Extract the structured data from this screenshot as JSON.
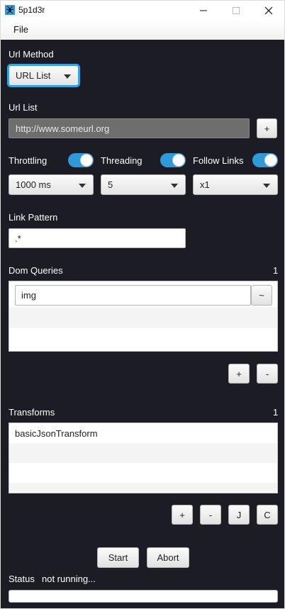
{
  "window": {
    "title": "5p1d3r"
  },
  "menu": {
    "file": "File"
  },
  "url_method": {
    "label": "Url Method",
    "selected": "URL List"
  },
  "url_list": {
    "label": "Url List",
    "value": "http://www.someurl.org",
    "add_label": "+"
  },
  "throttling": {
    "label": "Throttling",
    "enabled": true,
    "selected": "1000 ms"
  },
  "threading": {
    "label": "Threading",
    "enabled": true,
    "selected": "5"
  },
  "follow_links": {
    "label": "Follow Links",
    "enabled": true,
    "selected": "x1"
  },
  "link_pattern": {
    "label": "Link Pattern",
    "value": ".*"
  },
  "dom_queries": {
    "label": "Dom Queries",
    "count": "1",
    "items": [
      "img"
    ],
    "edit_label": "~",
    "add_label": "+",
    "remove_label": "-"
  },
  "transforms": {
    "label": "Transforms",
    "count": "1",
    "items": [
      "basicJsonTransform"
    ],
    "add_label": "+",
    "remove_label": "-",
    "json_label": "J",
    "custom_label": "C"
  },
  "actions": {
    "start": "Start",
    "abort": "Abort"
  },
  "status": {
    "label": "Status",
    "value": "not running...",
    "progress": 0
  },
  "colors": {
    "accent": "#2f9ad8",
    "background": "#1c1c24"
  }
}
